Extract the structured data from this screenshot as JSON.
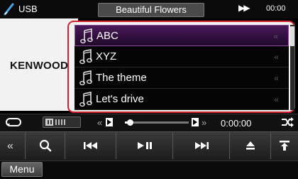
{
  "top_bar": {
    "source": "USB",
    "track_title": "Beautiful Flowers",
    "time": "00:00"
  },
  "brand": "KENWOOD",
  "playlist": {
    "items": [
      {
        "label": "ABC",
        "selected": true
      },
      {
        "label": "XYZ",
        "selected": false
      },
      {
        "label": "The theme",
        "selected": false
      },
      {
        "label": "Let's drive",
        "selected": false
      }
    ]
  },
  "status_bar": {
    "elapsed_time": "0:00:00",
    "progress_fraction": 0.05
  },
  "controls": {
    "buttons": [
      "collapse-icon",
      "search-icon",
      "previous-track-icon",
      "play-pause-icon",
      "next-track-icon",
      "eject-icon",
      "upload-icon"
    ]
  },
  "menu_label": "Menu",
  "colors": {
    "highlight_frame": "#d6202d",
    "selected_row": "#4b1a5a",
    "list_background": "#050505"
  }
}
